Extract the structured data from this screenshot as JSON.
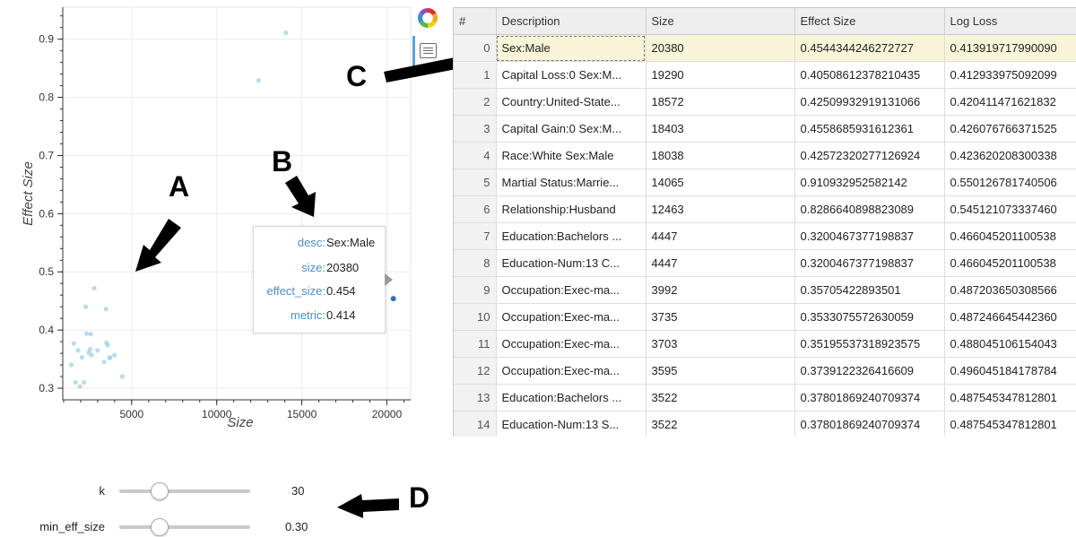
{
  "annotations": {
    "a": "A",
    "b": "B",
    "c": "C",
    "d": "D"
  },
  "toolbar": {
    "logo_icon": "bokeh-logo-icon",
    "hover_icon": "hover-tool-icon"
  },
  "chart_data": {
    "type": "scatter",
    "xlabel": "Size",
    "ylabel": "Effect Size",
    "xlim": [
      950,
      21400
    ],
    "ylim": [
      0.28,
      0.955
    ],
    "x_ticks": [
      5000,
      10000,
      15000,
      20000
    ],
    "x_tick_labels": [
      "5000",
      "10000",
      "15000",
      "20000"
    ],
    "y_ticks": [
      0.3,
      0.4,
      0.5,
      0.6,
      0.7,
      0.8,
      0.9
    ],
    "y_tick_labels": [
      "0.3",
      "0.4",
      "0.5",
      "0.6",
      "0.7",
      "0.8",
      "0.9"
    ],
    "grid": true,
    "point_color": "#a6cfe6",
    "highlight_color": "#2f6fb3",
    "points": [
      {
        "x": 20380,
        "y": 0.454
      },
      {
        "x": 19290,
        "y": 0.405
      },
      {
        "x": 18572,
        "y": 0.425
      },
      {
        "x": 18403,
        "y": 0.456
      },
      {
        "x": 18038,
        "y": 0.426
      },
      {
        "x": 14065,
        "y": 0.911
      },
      {
        "x": 12463,
        "y": 0.829
      },
      {
        "x": 4447,
        "y": 0.32
      },
      {
        "x": 3992,
        "y": 0.357
      },
      {
        "x": 3735,
        "y": 0.353
      },
      {
        "x": 3703,
        "y": 0.352
      },
      {
        "x": 3595,
        "y": 0.374
      },
      {
        "x": 3522,
        "y": 0.378
      },
      {
        "x": 3490,
        "y": 0.436
      },
      {
        "x": 3380,
        "y": 0.345
      },
      {
        "x": 2800,
        "y": 0.472
      },
      {
        "x": 2600,
        "y": 0.393
      },
      {
        "x": 2550,
        "y": 0.367
      },
      {
        "x": 2480,
        "y": 0.361
      },
      {
        "x": 2350,
        "y": 0.394
      },
      {
        "x": 2300,
        "y": 0.44
      },
      {
        "x": 2200,
        "y": 0.31
      },
      {
        "x": 2080,
        "y": 0.353
      },
      {
        "x": 1950,
        "y": 0.303
      },
      {
        "x": 1700,
        "y": 0.31
      },
      {
        "x": 1600,
        "y": 0.377
      },
      {
        "x": 1450,
        "y": 0.34
      },
      {
        "x": 2650,
        "y": 0.357
      },
      {
        "x": 3000,
        "y": 0.365
      },
      {
        "x": 1850,
        "y": 0.365
      }
    ],
    "highlight_index": 0
  },
  "tooltip": {
    "rows": [
      {
        "key": "desc:",
        "value": "Sex:Male"
      },
      {
        "key": "size:",
        "value": "20380"
      },
      {
        "key": "effect_size:",
        "value": "0.454"
      },
      {
        "key": "metric:",
        "value": "0.414"
      }
    ]
  },
  "table": {
    "columns": [
      "#",
      "Description",
      "Size",
      "Effect Size",
      "Log Loss"
    ],
    "rows": [
      [
        "0",
        "Sex:Male",
        "20380",
        "0.4544344246272727",
        "0.413919717990090"
      ],
      [
        "1",
        "Capital Loss:0 Sex:M...",
        "19290",
        "0.40508612378210435",
        "0.412933975092099"
      ],
      [
        "2",
        "Country:United-State...",
        "18572",
        "0.42509932919131066",
        "0.420411471621832"
      ],
      [
        "3",
        "Capital Gain:0 Sex:M...",
        "18403",
        "0.4558685931612361",
        "0.426076766371525"
      ],
      [
        "4",
        "Race:White Sex:Male",
        "18038",
        "0.42572320277126924",
        "0.423620208300338"
      ],
      [
        "5",
        "Martial Status:Marrie...",
        "14065",
        "0.910932952582142",
        "0.550126781740506"
      ],
      [
        "6",
        "Relationship:Husband",
        "12463",
        "0.8286640898823089",
        "0.545121073337460"
      ],
      [
        "7",
        "Education:Bachelors ...",
        "4447",
        "0.3200467377198837",
        "0.466045201100538"
      ],
      [
        "8",
        "Education-Num:13 C...",
        "4447",
        "0.3200467377198837",
        "0.466045201100538"
      ],
      [
        "9",
        "Occupation:Exec-ma...",
        "3992",
        "0.35705422893501",
        "0.487203650308566"
      ],
      [
        "10",
        "Occupation:Exec-ma...",
        "3735",
        "0.3533075572630059",
        "0.487246645442360"
      ],
      [
        "11",
        "Occupation:Exec-ma...",
        "3703",
        "0.35195537318923575",
        "0.488045106154043"
      ],
      [
        "12",
        "Occupation:Exec-ma...",
        "3595",
        "0.3739122326416609",
        "0.496045184178784"
      ],
      [
        "13",
        "Education:Bachelors ...",
        "3522",
        "0.37801869240709374",
        "0.487545347812801"
      ],
      [
        "14",
        "Education-Num:13 S...",
        "3522",
        "0.37801869240709374",
        "0.487545347812801"
      ]
    ],
    "selected_row": 0
  },
  "sliders": [
    {
      "label": "k",
      "value": "30",
      "fraction": 0.3
    },
    {
      "label": "min_eff_size",
      "value": "0.30",
      "fraction": 0.3
    }
  ]
}
